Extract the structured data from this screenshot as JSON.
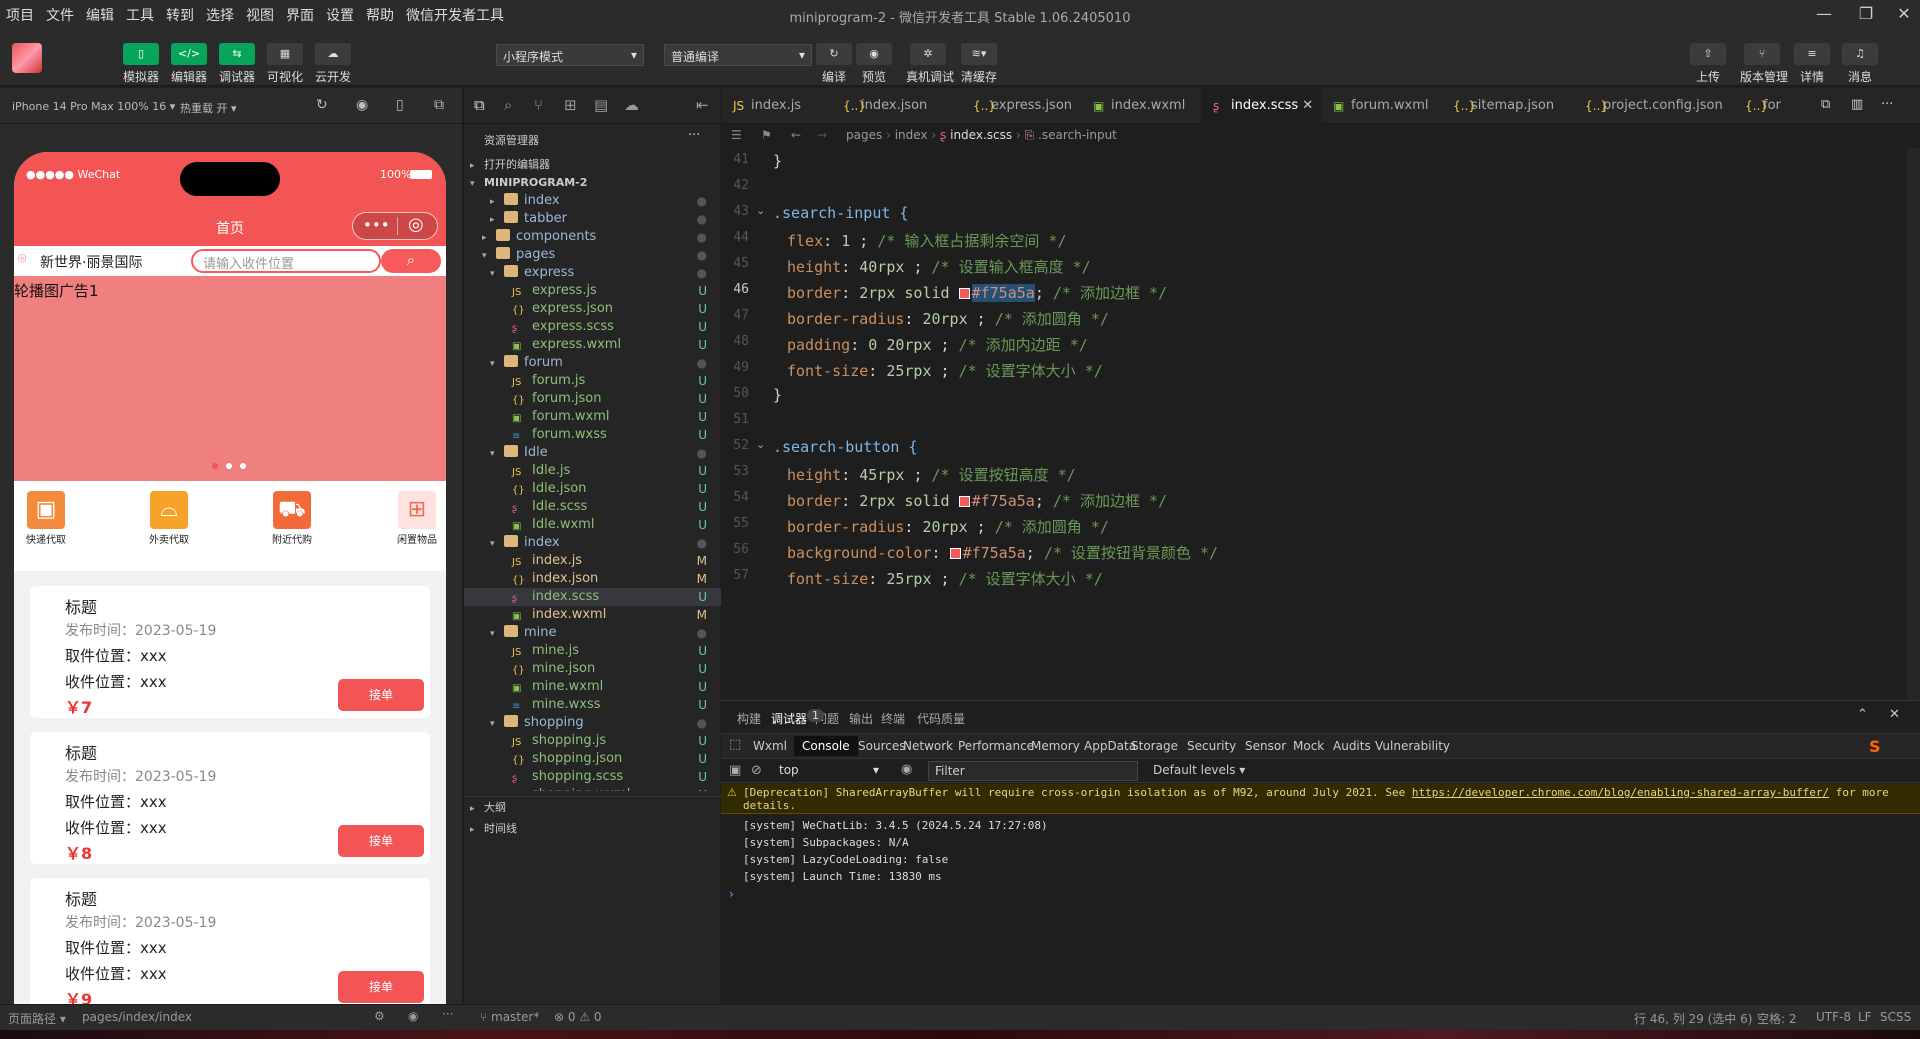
{
  "menubar": {
    "items": [
      "项目",
      "文件",
      "编辑",
      "工具",
      "转到",
      "选择",
      "视图",
      "界面",
      "设置",
      "帮助",
      "微信开发者工具"
    ],
    "title": "miniprogram-2 - 微信开发者工具 Stable 1.06.2405010"
  },
  "toolbar": {
    "simulator": "模拟器",
    "editor": "编辑器",
    "debugger": "调试器",
    "visual": "可视化",
    "cloud": "云开发",
    "mode": "小程序模式",
    "compile_mode": "普通编译",
    "compile": "编译",
    "preview": "预览",
    "real_debug": "真机调试",
    "clear_cache": "清缓存",
    "upload": "上传",
    "version": "版本管理",
    "details": "详情",
    "message": "消息"
  },
  "simbar": {
    "device": "iPhone 14 Pro Max 100% 16 ▾",
    "hotreload": "热重载 开 ▾"
  },
  "phone": {
    "carrier": "●●●●● WeChat",
    "battery": "100%",
    "nav_title": "首页",
    "location": "新世界·丽景国际",
    "search_placeholder": "请输入收件位置",
    "banner_text": "轮播图广告1",
    "categories": [
      "快递代取",
      "外卖代取",
      "附近代购",
      "闲置物品"
    ],
    "cards": [
      {
        "title": "标题",
        "date": "发布时间：2023-05-19",
        "pickup": "取件位置：xxx",
        "deliver": "收件位置：xxx",
        "price": "￥7",
        "btn": "接单"
      },
      {
        "title": "标题",
        "date": "发布时间：2023-05-19",
        "pickup": "取件位置：xxx",
        "deliver": "收件位置：xxx",
        "price": "￥8",
        "btn": "接单"
      },
      {
        "title": "标题",
        "date": "发布时间：2023-05-19",
        "pickup": "取件位置：xxx",
        "deliver": "收件位置：xxx",
        "price": "￥9",
        "btn": "接单"
      }
    ]
  },
  "explorer": {
    "title": "资源管理器",
    "open_editors": "打开的编辑器",
    "root": "MINIPROGRAM-2",
    "outline": "大纲",
    "timeline": "时间线",
    "tree": [
      {
        "d": 1,
        "name": "index",
        "type": "folder",
        "open": false,
        "st": "●"
      },
      {
        "d": 1,
        "name": "tabber",
        "type": "folder",
        "open": false,
        "st": "●"
      },
      {
        "d": 0,
        "name": "components",
        "type": "folder",
        "open": false,
        "st": "●"
      },
      {
        "d": 0,
        "name": "pages",
        "type": "folder",
        "open": true,
        "st": "●"
      },
      {
        "d": 1,
        "name": "express",
        "type": "folder",
        "open": true,
        "st": "●"
      },
      {
        "d": 2,
        "name": "express.js",
        "type": "js",
        "st": "U"
      },
      {
        "d": 2,
        "name": "express.json",
        "type": "json",
        "st": "U"
      },
      {
        "d": 2,
        "name": "express.scss",
        "type": "scss",
        "st": "U"
      },
      {
        "d": 2,
        "name": "express.wxml",
        "type": "wxml",
        "st": "U"
      },
      {
        "d": 1,
        "name": "forum",
        "type": "folder",
        "open": true,
        "st": "●"
      },
      {
        "d": 2,
        "name": "forum.js",
        "type": "js",
        "st": "U"
      },
      {
        "d": 2,
        "name": "forum.json",
        "type": "json",
        "st": "U"
      },
      {
        "d": 2,
        "name": "forum.wxml",
        "type": "wxml",
        "st": "U"
      },
      {
        "d": 2,
        "name": "forum.wxss",
        "type": "wxss",
        "st": "U"
      },
      {
        "d": 1,
        "name": "Idle",
        "type": "folder",
        "open": true,
        "st": "●"
      },
      {
        "d": 2,
        "name": "Idle.js",
        "type": "js",
        "st": "U"
      },
      {
        "d": 2,
        "name": "Idle.json",
        "type": "json",
        "st": "U"
      },
      {
        "d": 2,
        "name": "Idle.scss",
        "type": "scss",
        "st": "U"
      },
      {
        "d": 2,
        "name": "Idle.wxml",
        "type": "wxml",
        "st": "U"
      },
      {
        "d": 1,
        "name": "index",
        "type": "folder",
        "open": true,
        "st": "●"
      },
      {
        "d": 2,
        "name": "index.js",
        "type": "js",
        "st": "M"
      },
      {
        "d": 2,
        "name": "index.json",
        "type": "json",
        "st": "M"
      },
      {
        "d": 2,
        "name": "index.scss",
        "type": "scss",
        "st": "U",
        "sel": true
      },
      {
        "d": 2,
        "name": "index.wxml",
        "type": "wxml",
        "st": "M"
      },
      {
        "d": 1,
        "name": "mine",
        "type": "folder",
        "open": true,
        "st": "●"
      },
      {
        "d": 2,
        "name": "mine.js",
        "type": "js",
        "st": "U"
      },
      {
        "d": 2,
        "name": "mine.json",
        "type": "json",
        "st": "U"
      },
      {
        "d": 2,
        "name": "mine.wxml",
        "type": "wxml",
        "st": "U"
      },
      {
        "d": 2,
        "name": "mine.wxss",
        "type": "wxss",
        "st": "U"
      },
      {
        "d": 1,
        "name": "shopping",
        "type": "folder",
        "open": true,
        "st": "●"
      },
      {
        "d": 2,
        "name": "shopping.js",
        "type": "js",
        "st": "U"
      },
      {
        "d": 2,
        "name": "shopping.json",
        "type": "json",
        "st": "U"
      },
      {
        "d": 2,
        "name": "shopping.scss",
        "type": "scss",
        "st": "U"
      },
      {
        "d": 2,
        "name": "shopping.wxml",
        "type": "wxml",
        "st": "U"
      }
    ]
  },
  "tabs": [
    {
      "name": "index.js",
      "icon": "JS",
      "color": "#e8c94a"
    },
    {
      "name": "index.json",
      "icon": "{..}",
      "color": "#e8c94a"
    },
    {
      "name": "express.json",
      "icon": "{..}",
      "color": "#e8c94a"
    },
    {
      "name": "index.wxml",
      "icon": "▣",
      "color": "#8bc34a"
    },
    {
      "name": "index.scss",
      "icon": "ʂ",
      "color": "#e0609a",
      "active": true
    },
    {
      "name": "forum.wxml",
      "icon": "▣",
      "color": "#8bc34a"
    },
    {
      "name": "sitemap.json",
      "icon": "{..}",
      "color": "#e8c94a"
    },
    {
      "name": "project.config.json",
      "icon": "{..}",
      "color": "#e8c94a"
    },
    {
      "name": "for",
      "icon": "{..}",
      "color": "#e8c94a"
    }
  ],
  "breadcrumb": {
    "a": "pages",
    "b": "index",
    "c": "index.scss",
    "d": ".search-input"
  },
  "code": [
    {
      "n": "41",
      "t": "}"
    },
    {
      "n": "42",
      "t": ""
    },
    {
      "n": "43",
      "t": ".search-input {",
      "sel": true
    },
    {
      "n": "44",
      "prop": "flex",
      "val": "1",
      "cm": "/* 输入框占据剩余空间 */"
    },
    {
      "n": "45",
      "prop": "height",
      "val": "40rpx",
      "cm": "/* 设置输入框高度 */"
    },
    {
      "n": "46",
      "prop": "border",
      "val": "2rpx solid",
      "color": "#f75a5a",
      "cm": "/* 添加边框 */"
    },
    {
      "n": "47",
      "prop": "border-radius",
      "val": "20rpx",
      "cm": "/* 添加圆角 */"
    },
    {
      "n": "48",
      "prop": "padding",
      "val": "0 20rpx",
      "cm": "/* 添加内边距 */"
    },
    {
      "n": "49",
      "prop": "font-size",
      "val": "25rpx",
      "cm": "/* 设置字体大小 */"
    },
    {
      "n": "50",
      "t": "}"
    },
    {
      "n": "51",
      "t": ""
    },
    {
      "n": "52",
      "t": ".search-button {",
      "sel": true
    },
    {
      "n": "53",
      "prop": "height",
      "val": "45rpx",
      "cm": "/* 设置按钮高度 */"
    },
    {
      "n": "54",
      "prop": "border",
      "val": "2rpx solid",
      "color": "#f75a5a",
      "cm": "/* 添加边框 */"
    },
    {
      "n": "55",
      "prop": "border-radius",
      "val": "20rpx",
      "cm": "/* 添加圆角 */"
    },
    {
      "n": "56",
      "prop": "background-color",
      "val": "",
      "color": "#f75a5a",
      "cm": "/* 设置按钮背景颜色 */"
    },
    {
      "n": "57",
      "prop": "font-size",
      "val": "25rpx",
      "cm": "/* 设置字体大小 */"
    }
  ],
  "panel": {
    "tabs": [
      "构建",
      "调试器",
      "问题",
      "输出",
      "终端",
      "代码质量"
    ],
    "badge": "1",
    "devtabs": [
      "Wxml",
      "Console",
      "Sources",
      "Network",
      "Performance",
      "Memory",
      "AppData",
      "Storage",
      "Security",
      "Sensor",
      "Mock",
      "Audits",
      "Vulnerability"
    ],
    "context": "top",
    "filter": "Filter",
    "levels": "Default levels ▾",
    "warn": "[Deprecation] SharedArrayBuffer will require cross-origin isolation as of M92, around July 2021. See ",
    "warn_link": "https://developer.chrome.com/blog/enabling-shared-array-buffer/",
    "warn_tail": " for more",
    "warn2": "details.",
    "lines": [
      "[system] WeChatLib: 3.4.5 (2024.5.24 17:27:08)",
      "[system] Subpackages: N/A",
      "[system] LazyCodeLoading: false",
      "[system] Launch Time: 13830 ms"
    ]
  },
  "status": {
    "path_label": "页面路径 ▾",
    "path": "pages/index/index",
    "branch": "master*",
    "errors": "⊗ 0 ⚠ 0",
    "pos": "行 46, 列 29 (选中 6)",
    "spaces": "空格: 2",
    "enc": "UTF-8",
    "eol": "LF",
    "lang": "SCSS"
  }
}
